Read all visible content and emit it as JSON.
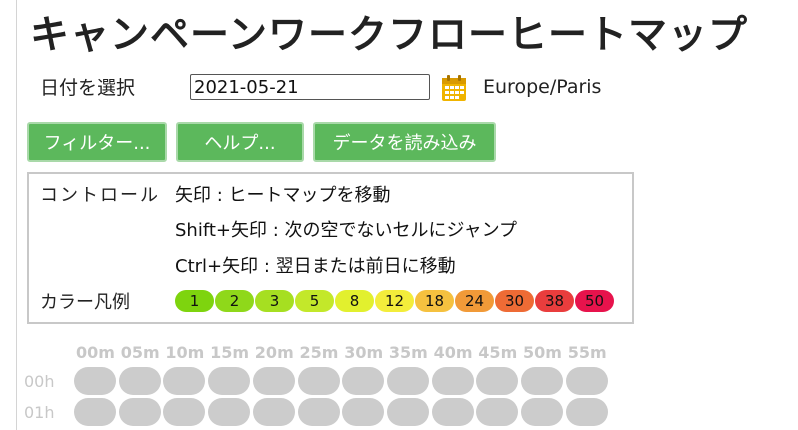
{
  "title": "キャンペーンワークフローヒートマップ",
  "date_picker": {
    "label": "日付を選択",
    "value": "2021-05-21",
    "icon": "calendar-icon",
    "timezone": "Europe/Paris"
  },
  "buttons": [
    {
      "label": "フィルター..."
    },
    {
      "label": "ヘルプ..."
    },
    {
      "label": "データを読み込み"
    }
  ],
  "controls": {
    "label": "コントロール",
    "lines": [
      "矢印 : ヒートマップを移動",
      "Shift+矢印 : 次の空でないセルにジャンプ",
      "Ctrl+矢印 : 翌日または前日に移動"
    ]
  },
  "legend": {
    "label": "カラー凡例",
    "items": [
      {
        "value": "1",
        "color": "#7ed40e"
      },
      {
        "value": "2",
        "color": "#8fd81a"
      },
      {
        "value": "3",
        "color": "#a6df21"
      },
      {
        "value": "5",
        "color": "#c3e82a"
      },
      {
        "value": "8",
        "color": "#e2f02e"
      },
      {
        "value": "12",
        "color": "#f3ed3b"
      },
      {
        "value": "18",
        "color": "#f5c13f"
      },
      {
        "value": "24",
        "color": "#f19a38"
      },
      {
        "value": "30",
        "color": "#ee6b35"
      },
      {
        "value": "38",
        "color": "#e93d3d"
      },
      {
        "value": "50",
        "color": "#e7134c"
      }
    ]
  },
  "heatmap": {
    "minutes": [
      "00m",
      "05m",
      "10m",
      "15m",
      "20m",
      "25m",
      "30m",
      "35m",
      "40m",
      "45m",
      "50m",
      "55m"
    ],
    "hours": [
      "00h",
      "01h"
    ],
    "empty_color": "#cccccc"
  }
}
